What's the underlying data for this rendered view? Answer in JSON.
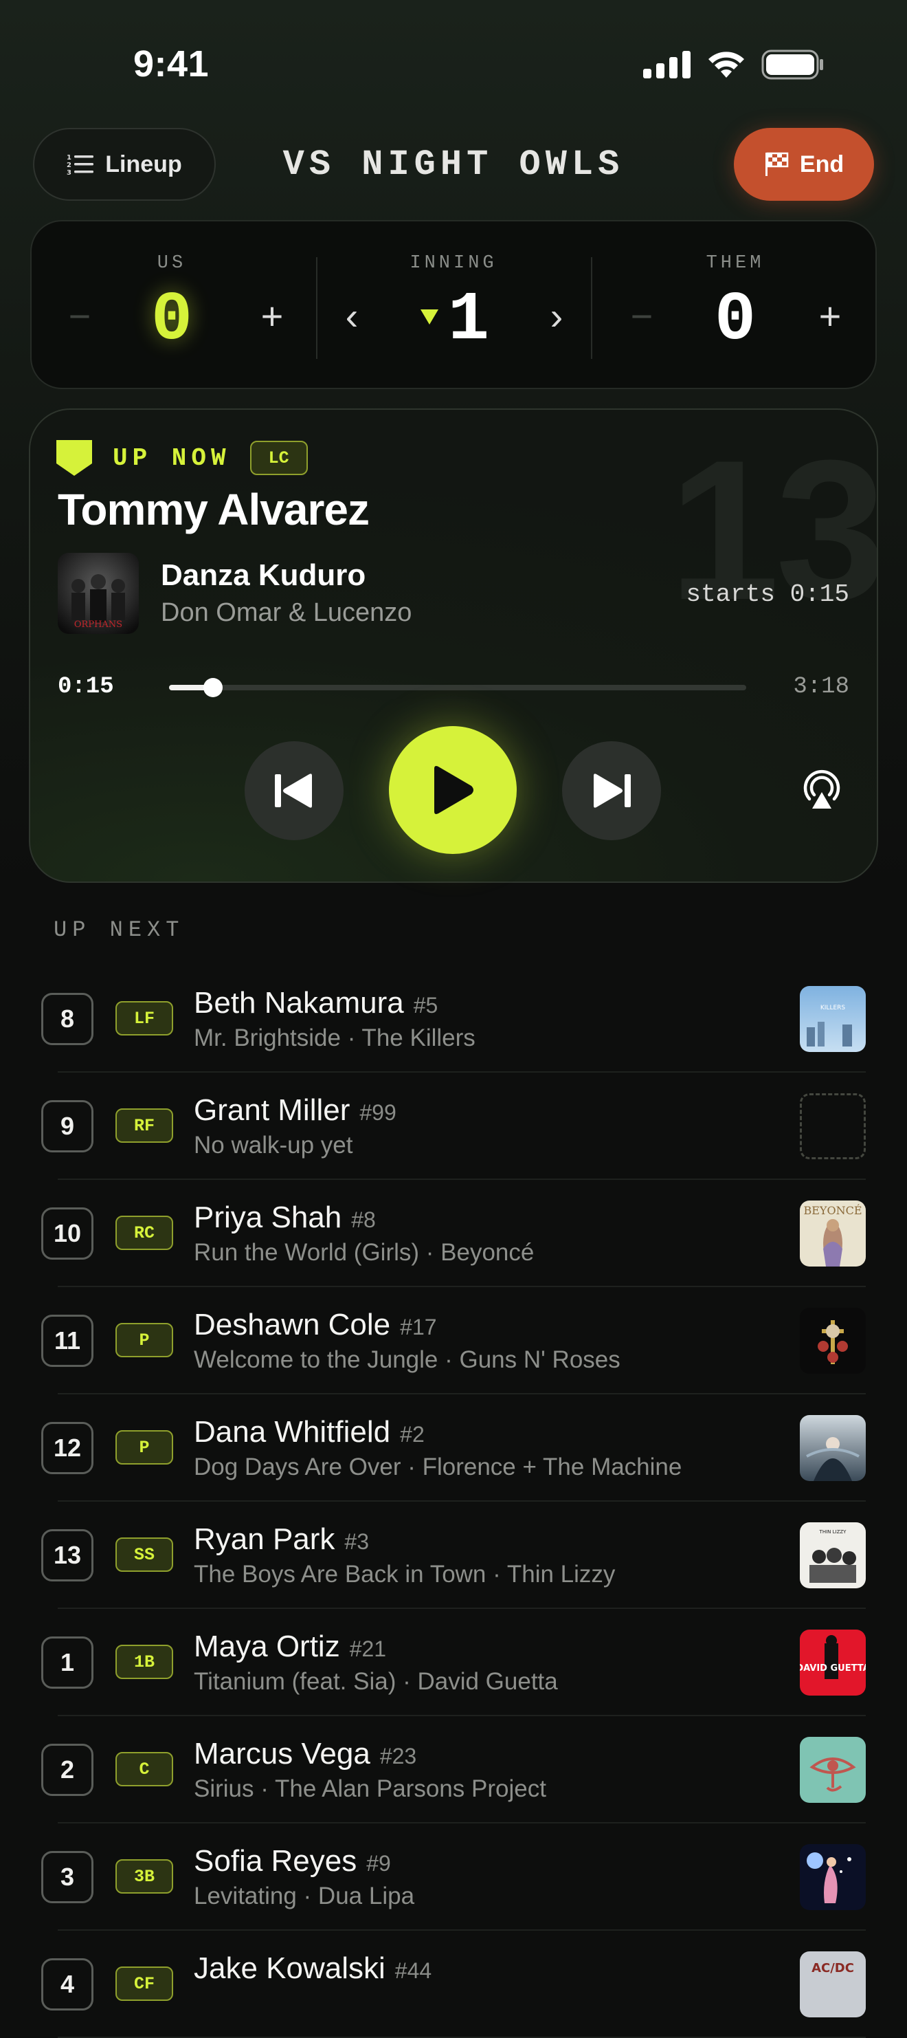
{
  "status_bar": {
    "time": "9:41"
  },
  "header": {
    "lineup_label": "Lineup",
    "title": "VS NIGHT OWLS",
    "end_label": "End"
  },
  "scoreboard": {
    "us_label": "US",
    "us_score": "0",
    "inning_label": "INNING",
    "inning": "1",
    "them_label": "THEM",
    "them_score": "0",
    "minus": "−",
    "plus": "+",
    "prev": "‹",
    "next": "›"
  },
  "now_playing": {
    "label": "UP NOW",
    "position": "LC",
    "jersey": "13",
    "player": "Tommy Alvarez",
    "song": "Danza Kuduro",
    "artist": "Don Omar & Lucenzo",
    "starts": "starts 0:15",
    "current_time": "0:15",
    "total_time": "3:18",
    "progress_fraction": 0.076,
    "album_text": "ORPHANS"
  },
  "up_next": {
    "label": "UP NEXT",
    "rows": [
      {
        "order": "8",
        "pos": "LF",
        "name": "Beth Nakamura",
        "num": "#5",
        "sub": "Mr. Brightside · The Killers",
        "art": "killers"
      },
      {
        "order": "9",
        "pos": "RF",
        "name": "Grant Miller",
        "num": "#99",
        "sub": "No walk-up yet",
        "art": "none"
      },
      {
        "order": "10",
        "pos": "RC",
        "name": "Priya Shah",
        "num": "#8",
        "sub": "Run the World (Girls) · Beyoncé",
        "art": "beyonce"
      },
      {
        "order": "11",
        "pos": "P",
        "name": "Deshawn Cole",
        "num": "#17",
        "sub": "Welcome to the Jungle · Guns N' Roses",
        "art": "gnr"
      },
      {
        "order": "12",
        "pos": "P",
        "name": "Dana Whitfield",
        "num": "#2",
        "sub": "Dog Days Are Over · Florence + The Machine",
        "art": "florence"
      },
      {
        "order": "13",
        "pos": "SS",
        "name": "Ryan Park",
        "num": "#3",
        "sub": "The Boys Are Back in Town · Thin Lizzy",
        "art": "lizzy"
      },
      {
        "order": "1",
        "pos": "1B",
        "name": "Maya Ortiz",
        "num": "#21",
        "sub": "Titanium (feat. Sia) · David Guetta",
        "art": "guetta"
      },
      {
        "order": "2",
        "pos": "C",
        "name": "Marcus Vega",
        "num": "#23",
        "sub": "Sirius · The Alan Parsons Project",
        "art": "parsons"
      },
      {
        "order": "3",
        "pos": "3B",
        "name": "Sofia Reyes",
        "num": "#9",
        "sub": "Levitating · Dua Lipa",
        "art": "dualipa"
      },
      {
        "order": "4",
        "pos": "CF",
        "name": "Jake Kowalski",
        "num": "#44",
        "sub": "",
        "art": "acdc"
      }
    ]
  },
  "album_texts": {
    "beyonce": "BEYONCÉ",
    "guetta": "DAVID GUETTA",
    "acdc": "AC/DC",
    "killers": "KILLERS"
  },
  "colors": {
    "accent": "#d6f23a",
    "end_button": "#c4502d",
    "background": "#0d0e0d"
  }
}
